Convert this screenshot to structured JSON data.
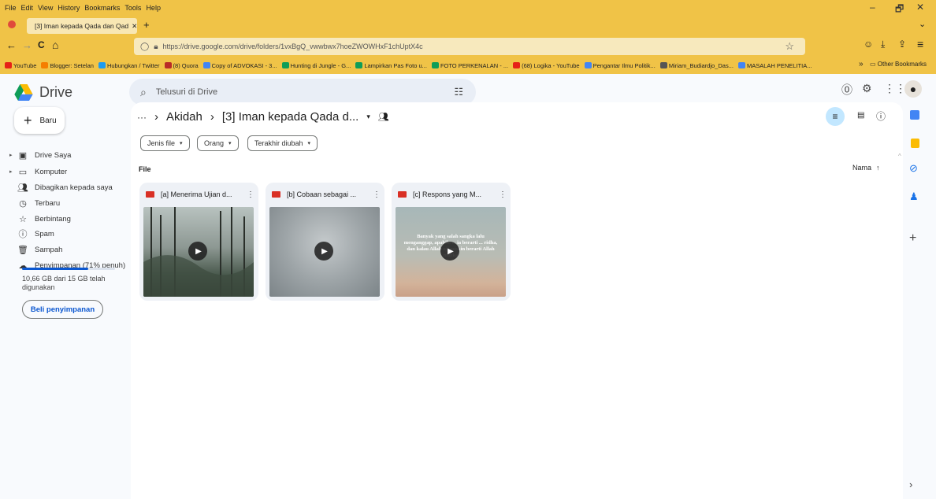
{
  "menubar": {
    "items": [
      "File",
      "Edit",
      "View",
      "History",
      "Bookmarks",
      "Tools",
      "Help"
    ]
  },
  "window": {
    "minimize": "–",
    "maximize": "🗗",
    "close": "✕"
  },
  "tab": {
    "title": "[3] Iman kepada Qada dan Qad",
    "close": "✕",
    "new": "+",
    "list": "⌄"
  },
  "nav": {
    "back": "←",
    "forward": "→",
    "reload": "C",
    "home": "⌂",
    "url": "https://drive.google.com/drive/folders/1vxBgQ_vwwbwx7hoeZWOWHxF1chUptX4c",
    "star": "☆",
    "pocket": "☺",
    "download": "⤓",
    "account": "⇪",
    "menu": "≡"
  },
  "bookmarks": [
    {
      "label": "YouTube",
      "color": "#e62117"
    },
    {
      "label": "Blogger: Setelan",
      "color": "#f57d00"
    },
    {
      "label": "Hubungkan / Twitter",
      "color": "#1d9bf0"
    },
    {
      "label": "(8) Quora",
      "color": "#b92b27"
    },
    {
      "label": "Copy of ADVOKASI - 3...",
      "color": "#4285f4"
    },
    {
      "label": "Hunting di Jungle - G...",
      "color": "#0f9d58"
    },
    {
      "label": "Lampirkan Pas Foto u...",
      "color": "#0f9d58"
    },
    {
      "label": "FOTO PERKENALAN - ...",
      "color": "#0f9d58"
    },
    {
      "label": "(68) Logika - YouTube",
      "color": "#e62117"
    },
    {
      "label": "Pengantar Ilmu Politik...",
      "color": "#4285f4"
    },
    {
      "label": "Miriam_Budiardjo_Das...",
      "color": "#555555"
    },
    {
      "label": "MASALAH PENELITIA...",
      "color": "#4285f4"
    }
  ],
  "bookmarks_more": "»",
  "other_bookmarks": "Other Bookmarks",
  "app": {
    "brand": "Drive",
    "search_placeholder": "Telusuri di Drive",
    "new_label": "Baru",
    "sidebar": [
      {
        "label": "Drive Saya",
        "icon": "drive-icon",
        "caret": true
      },
      {
        "label": "Komputer",
        "icon": "computer-icon",
        "caret": true
      },
      {
        "label": "Dibagikan kepada saya",
        "icon": "shared-icon",
        "caret": false
      },
      {
        "label": "Terbaru",
        "icon": "clock-icon",
        "caret": false
      },
      {
        "label": "Berbintang",
        "icon": "star-icon",
        "caret": false
      },
      {
        "label": "Spam",
        "icon": "spam-icon",
        "caret": false
      },
      {
        "label": "Sampah",
        "icon": "trash-icon",
        "caret": false
      },
      {
        "label": "Penyimpanan (71% penuh)",
        "icon": "cloud-icon",
        "caret": false
      }
    ],
    "storage_fraction": 0.71,
    "storage_text": "10,66 GB dari 15 GB telah digunakan",
    "buy_label": "Beli penyimpanan",
    "breadcrumb": {
      "ellipsis": "···",
      "sep": "›",
      "parent": "Akidah",
      "current": "[3] Iman kepada Qada d..."
    },
    "filters": [
      "Jenis file",
      "Orang",
      "Terakhir diubah"
    ],
    "file_section": "File",
    "sort_label": "Nama",
    "files": [
      {
        "name": "[a] Menerima Ujian d...",
        "overlay": ""
      },
      {
        "name": "[b] Cobaan sebagai ...",
        "overlay": ""
      },
      {
        "name": "[c] Respons yang M...",
        "overlay": "Banyak yang salah sangka lalu menganggap, apabila ... ia berarti ... ridha, dan kalau Allah uji miskin berarti Allah murka"
      }
    ]
  }
}
